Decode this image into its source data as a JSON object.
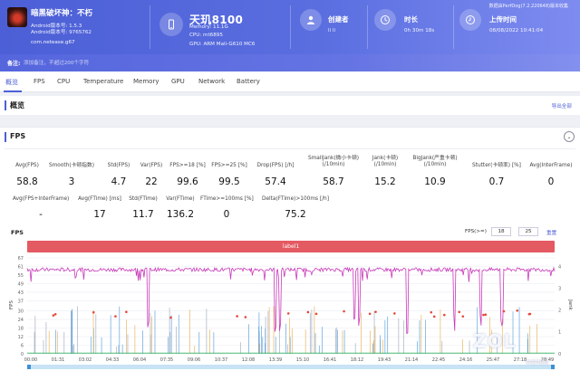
{
  "header": {
    "app_name": "暗黑破坏神：不朽",
    "android_version": "Android版本号: 1.5.3",
    "android_build": "Android版本号: 9765762",
    "package": "com.netease.g67",
    "chip_name": "天玑8100",
    "memory": "Memory: 11.1G",
    "cpu": "CPU: mt6895",
    "gpu": "GPU: ARM Mali-G610 MC6",
    "creator_label": "创建者",
    "creator_value": "li li",
    "duration_label": "时长",
    "duration_value": "0h 30m 18s",
    "upload_label": "上传时间",
    "upload_value": "08/08/2022 10:41:04",
    "version_text": "数据由PerfDog(7.2.220648)版本收集"
  },
  "note": {
    "label": "备注:",
    "placeholder": "添加备注，不超过200个字符"
  },
  "tabs": [
    "概览",
    "FPS",
    "CPU",
    "Temperature",
    "Memory",
    "GPU",
    "Network",
    "Battery"
  ],
  "overview": {
    "title": "概览",
    "export": "导出全部"
  },
  "fps_section": {
    "title": "FPS",
    "stats_row1": [
      {
        "label": "Avg(FPS)",
        "value": "58.8"
      },
      {
        "label": "Smooth(卡顿指数)",
        "value": "3"
      },
      {
        "label": "Std(FPS)",
        "value": "4.7"
      },
      {
        "label": "Var(FPS)",
        "value": "22"
      },
      {
        "label": "FPS>=18 [%]",
        "value": "99.6"
      },
      {
        "label": "FPS>=25 [%]",
        "value": "99.5"
      },
      {
        "label": "Drop(FPS) [/h]",
        "value": "57.4"
      },
      {
        "label": "SmallJank(微小卡顿)\n(/10min)",
        "value": "58.7"
      },
      {
        "label": "Jank(卡顿)\n(/10min)",
        "value": "15.2"
      },
      {
        "label": "BigJank(严重卡顿)\n(/10min)",
        "value": "10.9"
      },
      {
        "label": "Stutter(卡顿率) [%]",
        "value": "0.7"
      },
      {
        "label": "Avg(InterFrame)",
        "value": "0"
      }
    ],
    "stats_row2": [
      {
        "label": "Avg(FPS+InterFrame)",
        "value": "-"
      },
      {
        "label": "Avg(FTime) [ms]",
        "value": "17"
      },
      {
        "label": "Std(FTime)",
        "value": "11.7"
      },
      {
        "label": "Var(FTime)",
        "value": "136.2"
      },
      {
        "label": "FTime>=100ms [%]",
        "value": "0"
      },
      {
        "label": "Delta(FTime)>100ms [/h]",
        "value": "75.2"
      }
    ],
    "chart_title": "FPS",
    "fps_filter_label": "FPS(>=)",
    "fps_filter_1": "18",
    "fps_filter_2": "25",
    "reset_label": "重置",
    "label_bar": "label1",
    "watermark": "ZOL",
    "watermark_sub": "中关村在线"
  },
  "chart_data": {
    "type": "line",
    "ylabel": "FPS",
    "y2label": "Jank",
    "yticks": [
      0,
      6,
      12,
      18,
      24,
      30,
      37,
      43,
      49,
      55,
      61,
      67
    ],
    "y2ticks": [
      0,
      1,
      2,
      3,
      4
    ],
    "xticks": [
      "00:00",
      "01:31",
      "03:02",
      "04:33",
      "06:04",
      "07:35",
      "09:06",
      "10:37",
      "12:08",
      "13:39",
      "15:10",
      "16:41",
      "18:12",
      "19:43",
      "21:14",
      "22:45",
      "24:16",
      "25:47",
      "27:18",
      "28:49"
    ],
    "series": [
      {
        "name": "FPS",
        "color": "#c83ab9",
        "baseline": 58.8
      },
      {
        "name": "Smooth",
        "color": "#3d8fd6"
      },
      {
        "name": "SmallJank",
        "color": "#8f9fb6"
      },
      {
        "name": "Jank",
        "color": "#e6a43a"
      },
      {
        "name": "BigJank",
        "color": "#e34a3c"
      },
      {
        "name": "Stutter",
        "color": "#4dbd74"
      },
      {
        "name": "InterFrame",
        "color": "#9b59b6"
      }
    ]
  }
}
